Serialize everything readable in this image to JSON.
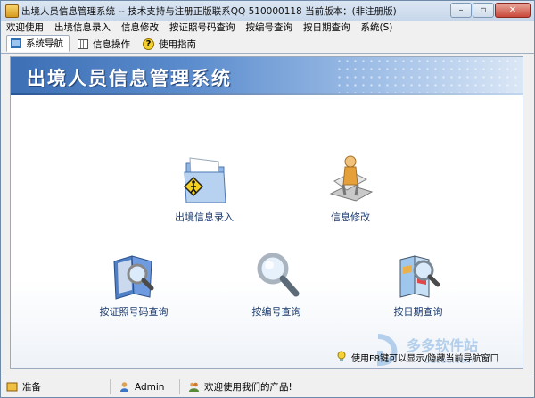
{
  "window": {
    "title": "出境人员信息管理系统 -- 技术支持与注册正版联系QQ 510000118   当前版本：(非注册版)",
    "buttons": {
      "minimize": "–",
      "maximize": "▫",
      "close": "✕"
    }
  },
  "menubar": {
    "items": [
      {
        "label": "欢迎使用"
      },
      {
        "label": "出境信息录入"
      },
      {
        "label": "信息修改"
      },
      {
        "label": "按证照号码查询"
      },
      {
        "label": "按编号查询"
      },
      {
        "label": "按日期查询"
      },
      {
        "label": "系统(S)"
      }
    ]
  },
  "tabs": [
    {
      "label": "系统导航",
      "icon": "monitor-icon",
      "active": true
    },
    {
      "label": "信息操作",
      "icon": "grid-icon",
      "active": false
    },
    {
      "label": "使用指南",
      "icon": "help-icon",
      "active": false
    }
  ],
  "banner": {
    "title": "出境人员信息管理系统"
  },
  "features": [
    {
      "label": "出境信息录入",
      "icon": "folder-person-icon"
    },
    {
      "label": "信息修改",
      "icon": "person-edit-icon"
    },
    {
      "label": "按证照号码查询",
      "icon": "book-search-icon"
    },
    {
      "label": "按编号查询",
      "icon": "magnifier-icon"
    },
    {
      "label": "按日期查询",
      "icon": "map-search-icon"
    }
  ],
  "hint": {
    "text": "使用F8键可以显示/隐藏当前导航窗口"
  },
  "watermark": {
    "text": "多多软件站",
    "url": "ddooo.com"
  },
  "statusbar": {
    "ready": "准备",
    "user": "Admin",
    "welcome": "欢迎使用我们的产品!"
  },
  "colors": {
    "banner_start": "#3d6fb5",
    "banner_end": "#dbe7f6",
    "label_text": "#1a3a6e"
  }
}
